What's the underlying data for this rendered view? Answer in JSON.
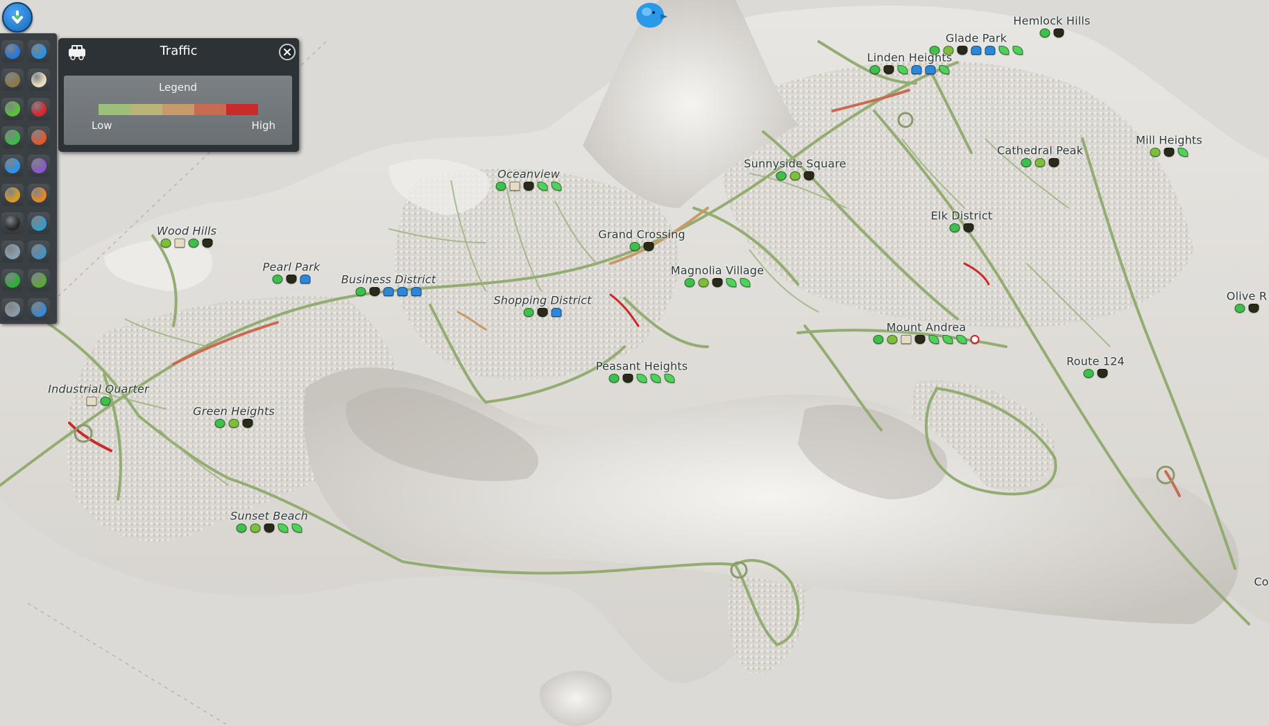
{
  "panel": {
    "title": "Traffic",
    "legend_title": "Legend",
    "low_label": "Low",
    "high_label": "High",
    "legend_colors": [
      "#9cc07a",
      "#b8b575",
      "#c79a68",
      "#c96b52",
      "#c92a2a"
    ]
  },
  "toolbar": {
    "items": [
      {
        "icon": "electricity-icon",
        "color": "#2b78d8"
      },
      {
        "icon": "water-drop-icon",
        "color": "#2f8fe0"
      },
      {
        "icon": "garbage-icon",
        "color": "#8a7a4a"
      },
      {
        "icon": "education-book-icon",
        "color": "#e7dcc0"
      },
      {
        "icon": "happiness-smiley-icon",
        "color": "#59c23a"
      },
      {
        "icon": "health-heart-icon",
        "color": "#d8262d"
      },
      {
        "icon": "landmark-star-icon",
        "color": "#3fb84a"
      },
      {
        "icon": "wind-sock-icon",
        "color": "#e05a2e"
      },
      {
        "icon": "traffic-car-icon",
        "color": "#2f92e6"
      },
      {
        "icon": "pollution-barrel-icon",
        "color": "#8a58c8"
      },
      {
        "icon": "noise-headphones-icon",
        "color": "#d49a2c"
      },
      {
        "icon": "fire-helmet-icon",
        "color": "#e08a2a"
      },
      {
        "icon": "crime-mask-icon",
        "color": "#2a2a2a"
      },
      {
        "icon": "public-transport-bus-icon",
        "color": "#3a9ac8"
      },
      {
        "icon": "population-person-icon",
        "color": "#8aa0b0"
      },
      {
        "icon": "land-value-icon",
        "color": "#4a90c0"
      },
      {
        "icon": "money-dollar-icon",
        "color": "#2fae3a"
      },
      {
        "icon": "resources-cube-icon",
        "color": "#5aa83a"
      },
      {
        "icon": "terrain-icon",
        "color": "#8a9aa6"
      },
      {
        "icon": "clock-icon",
        "color": "#3a88d0"
      }
    ]
  },
  "districts": [
    {
      "name": "Hemlock Hills",
      "icons": [
        "recycle",
        "fire"
      ]
    },
    {
      "name": "Glade Park",
      "icons": [
        "recycle",
        "tree",
        "fire",
        "water",
        "water",
        "leaf",
        "leaf"
      ]
    },
    {
      "name": "Linden Heights",
      "icons": [
        "recycle",
        "fire",
        "leaf",
        "water",
        "water",
        "leaf"
      ]
    },
    {
      "name": "Mill Heights",
      "icons": [
        "tree",
        "fire",
        "leaf"
      ]
    },
    {
      "name": "Cathedral Peak",
      "icons": [
        "recycle",
        "tree",
        "fire"
      ]
    },
    {
      "name": "Sunnyside Square",
      "icons": [
        "recycle",
        "tree",
        "fire"
      ]
    },
    {
      "name": "Oceanview",
      "icons": [
        "recycle",
        "book",
        "fire",
        "leaf",
        "leaf"
      ]
    },
    {
      "name": "Elk District",
      "icons": [
        "recycle",
        "fire"
      ]
    },
    {
      "name": "Grand Crossing",
      "icons": [
        "recycle",
        "fire"
      ]
    },
    {
      "name": "Wood Hills",
      "icons": [
        "tree",
        "book",
        "recycle",
        "fire"
      ]
    },
    {
      "name": "Pearl Park",
      "icons": [
        "recycle",
        "fire",
        "water"
      ]
    },
    {
      "name": "Business District",
      "icons": [
        "recycle",
        "fire",
        "water",
        "water",
        "water"
      ]
    },
    {
      "name": "Magnolia Village",
      "icons": [
        "recycle",
        "tree",
        "fire",
        "leaf",
        "leaf"
      ]
    },
    {
      "name": "Shopping District",
      "icons": [
        "recycle",
        "fire",
        "water"
      ]
    },
    {
      "name": "Olive R",
      "icons": [
        "recycle",
        "fire"
      ]
    },
    {
      "name": "Mount Andrea",
      "icons": [
        "recycle",
        "tree",
        "book",
        "fire",
        "leaf",
        "leaf",
        "leaf",
        "ban"
      ]
    },
    {
      "name": "Peasant Heights",
      "icons": [
        "recycle",
        "fire",
        "leaf",
        "leaf",
        "leaf"
      ]
    },
    {
      "name": "Route 124",
      "icons": [
        "recycle",
        "fire"
      ]
    },
    {
      "name": "Industrial Quarter",
      "icons": [
        "book",
        "recycle"
      ]
    },
    {
      "name": "Green Heights",
      "icons": [
        "recycle",
        "tree",
        "fire"
      ]
    },
    {
      "name": "Sunset Beach",
      "icons": [
        "recycle",
        "tree",
        "fire",
        "leaf",
        "leaf"
      ]
    },
    {
      "name": "Co",
      "icons": []
    }
  ]
}
